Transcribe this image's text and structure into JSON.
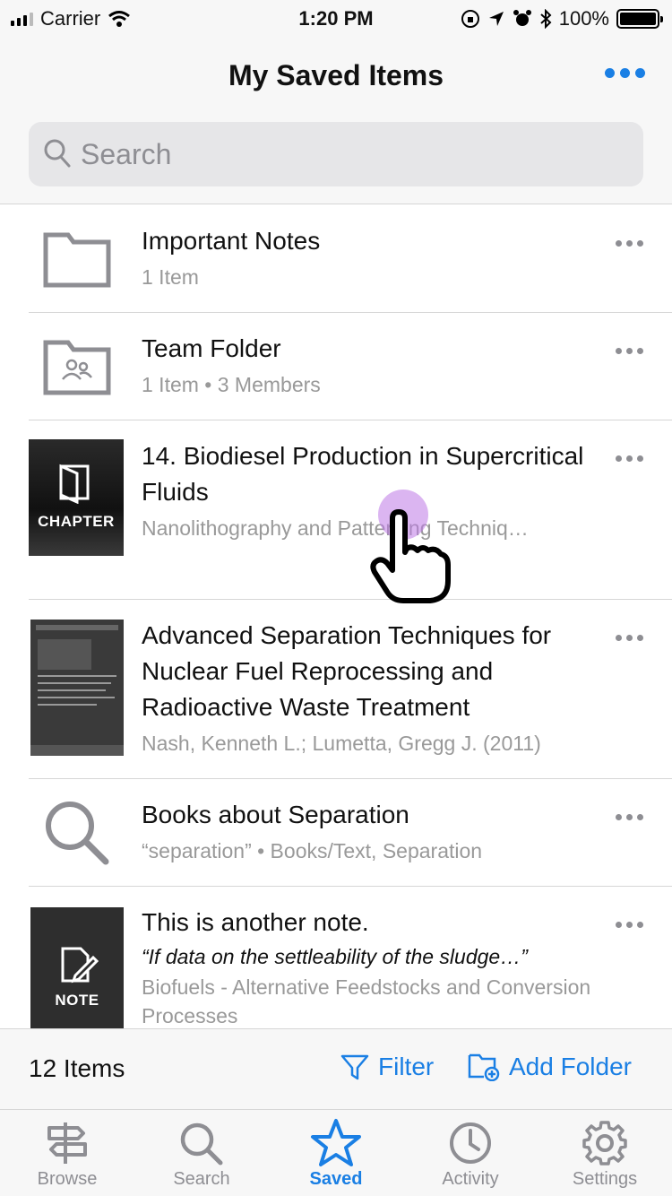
{
  "status_bar": {
    "carrier": "Carrier",
    "time": "1:20 PM",
    "battery": "100%"
  },
  "header": {
    "title": "My Saved Items"
  },
  "search": {
    "placeholder": "Search"
  },
  "items": [
    {
      "title": "Important Notes",
      "subtitle": "1 Item",
      "icon": "folder-icon"
    },
    {
      "title": "Team Folder",
      "subtitle": "1 Item • 3 Members",
      "icon": "shared-folder-icon"
    },
    {
      "title": "14. Biodiesel Production in Supercritical Fluids",
      "subtitle": "Nanolithography and Patterning Techniq…",
      "badge": "CHAPTER",
      "icon": "book-chapter-icon"
    },
    {
      "title": "Advanced Separation Techniques for Nuclear Fuel Reprocessing and Radioactive Waste Treatment",
      "subtitle": "Nash, Kenneth L.; Lumetta, Gregg J. (2011)",
      "icon": "book-cover"
    },
    {
      "title": "Books about Separation",
      "subtitle": "“separation” • Books/Text, Separation",
      "icon": "search-icon"
    },
    {
      "title": "This is another note.",
      "quote": "“If data on the settleability of the sludge…”",
      "subtitle": "Biofuels - Alternative Feedstocks and Conversion Processes",
      "badge": "NOTE",
      "icon": "note-icon"
    }
  ],
  "toolbar": {
    "count": "12 Items",
    "filter": "Filter",
    "add_folder": "Add Folder"
  },
  "tabs": [
    {
      "label": "Browse",
      "icon": "signpost-icon"
    },
    {
      "label": "Search",
      "icon": "search-icon"
    },
    {
      "label": "Saved",
      "icon": "star-icon",
      "active": true
    },
    {
      "label": "Activity",
      "icon": "clock-icon"
    },
    {
      "label": "Settings",
      "icon": "gear-icon"
    }
  ],
  "colors": {
    "accent": "#1a7fe4",
    "secondary_text": "#999999",
    "touch_indicator": "#be78e6"
  }
}
